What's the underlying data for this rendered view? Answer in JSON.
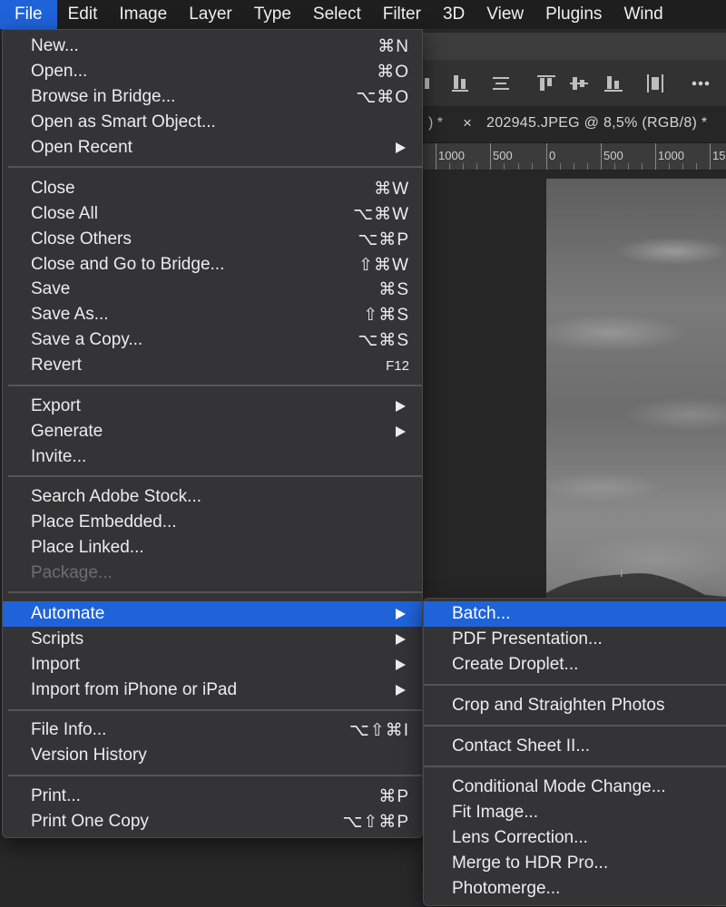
{
  "menubar": {
    "items": [
      {
        "label": "File",
        "active": true
      },
      {
        "label": "Edit"
      },
      {
        "label": "Image"
      },
      {
        "label": "Layer"
      },
      {
        "label": "Type"
      },
      {
        "label": "Select"
      },
      {
        "label": "Filter"
      },
      {
        "label": "3D"
      },
      {
        "label": "View"
      },
      {
        "label": "Plugins"
      },
      {
        "label": "Wind"
      }
    ]
  },
  "document": {
    "prev_tab_suffix": ") *",
    "tab_close": "×",
    "tab_title": "202945.JPEG @ 8,5% (RGB/8) *",
    "ruler_labels": [
      "1000",
      "500",
      "0",
      "500",
      "1000",
      "15"
    ]
  },
  "file_menu": {
    "items": [
      {
        "label": "New...",
        "shortcut": "⌘N"
      },
      {
        "label": "Open...",
        "shortcut": "⌘O"
      },
      {
        "label": "Browse in Bridge...",
        "shortcut": "⌥⌘O"
      },
      {
        "label": "Open as Smart Object..."
      },
      {
        "label": "Open Recent",
        "submenu": true
      },
      {
        "label": "Close",
        "shortcut": "⌘W"
      },
      {
        "label": "Close All",
        "shortcut": "⌥⌘W"
      },
      {
        "label": "Close Others",
        "shortcut": "⌥⌘P"
      },
      {
        "label": "Close and Go to Bridge...",
        "shortcut": "⇧⌘W"
      },
      {
        "label": "Save",
        "shortcut": "⌘S"
      },
      {
        "label": "Save As...",
        "shortcut": "⇧⌘S"
      },
      {
        "label": "Save a Copy...",
        "shortcut": "⌥⌘S"
      },
      {
        "label": "Revert",
        "shortcut": "F12"
      },
      {
        "label": "Export",
        "submenu": true
      },
      {
        "label": "Generate",
        "submenu": true
      },
      {
        "label": "Invite..."
      },
      {
        "label": "Search Adobe Stock..."
      },
      {
        "label": "Place Embedded..."
      },
      {
        "label": "Place Linked..."
      },
      {
        "label": "Package...",
        "disabled": true
      },
      {
        "label": "Automate",
        "submenu": true,
        "highlighted": true
      },
      {
        "label": "Scripts",
        "submenu": true
      },
      {
        "label": "Import",
        "submenu": true
      },
      {
        "label": "Import from iPhone or iPad",
        "submenu": true
      },
      {
        "label": "File Info...",
        "shortcut": "⌥⇧⌘I"
      },
      {
        "label": "Version History"
      },
      {
        "label": "Print...",
        "shortcut": "⌘P"
      },
      {
        "label": "Print One Copy",
        "shortcut": "⌥⇧⌘P"
      }
    ]
  },
  "automate_submenu": {
    "items": [
      {
        "label": "Batch...",
        "highlighted": true
      },
      {
        "label": "PDF Presentation..."
      },
      {
        "label": "Create Droplet..."
      },
      {
        "label": "Crop and Straighten Photos"
      },
      {
        "label": "Contact Sheet II..."
      },
      {
        "label": "Conditional Mode Change..."
      },
      {
        "label": "Fit Image..."
      },
      {
        "label": "Lens Correction..."
      },
      {
        "label": "Merge to HDR Pro..."
      },
      {
        "label": "Photomerge..."
      }
    ]
  },
  "colors": {
    "highlight": "#1f63d9",
    "menu_bg": "#343436",
    "disabled_text": "#6e6e70"
  }
}
